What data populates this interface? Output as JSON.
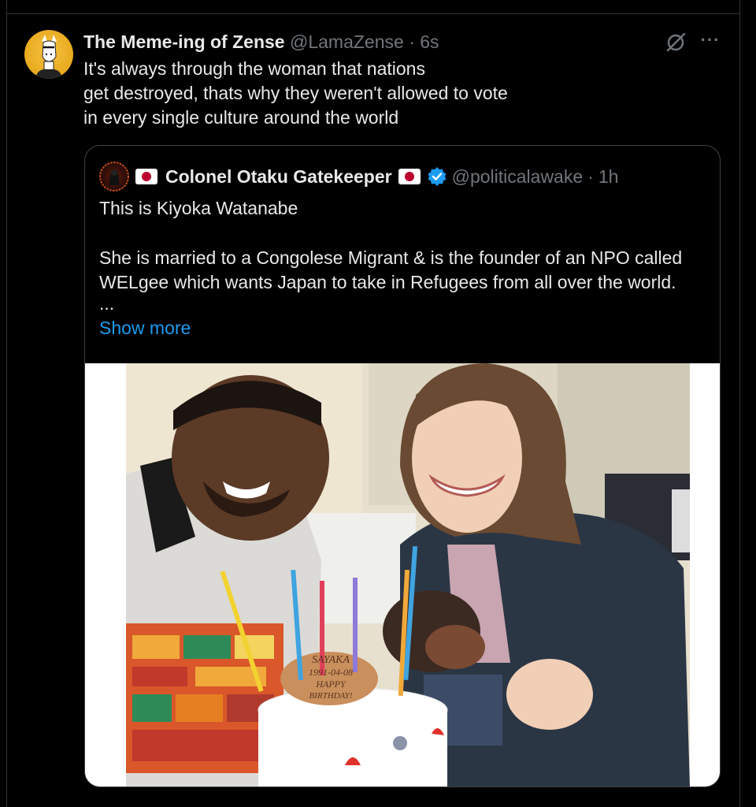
{
  "tweet": {
    "author_name": "The Meme-ing of Zense",
    "author_handle": "@LamaZense",
    "separator": "·",
    "time": "6s",
    "text_lines": [
      "It's always through the woman that nations",
      "get destroyed, thats why they weren't allowed to vote",
      "in every single culture around the world"
    ],
    "avatar_icon": "llama-avatar-icon",
    "grok_icon": "grok-icon",
    "more_icon": "more-options-icon",
    "more_label": "···"
  },
  "quoted_tweet": {
    "author_name": "Colonel Otaku Gatekeeper",
    "author_handle": "@politicalawake",
    "separator": "·",
    "time": "1h",
    "flag_icon": "japan-flag-icon",
    "verified_icon": "verified-badge-icon",
    "text_line_1": "This is Kiyoka Watanabe",
    "text_line_2": "She is married to a Congolese Migrant & is the founder of an NPO called",
    "text_line_3": "WELgee which wants Japan to take in Refugees from all over the world.",
    "ellipsis": "...",
    "show_more_label": "Show more",
    "cake_text_lines": [
      "SAYAKA",
      "1991-04-08",
      "HAPPY",
      "BIRTHDAY!"
    ]
  },
  "colors": {
    "background": "#000000",
    "text": "#e7e9ea",
    "muted": "#71767b",
    "link": "#1d9bf0",
    "border": "#2f3336"
  }
}
